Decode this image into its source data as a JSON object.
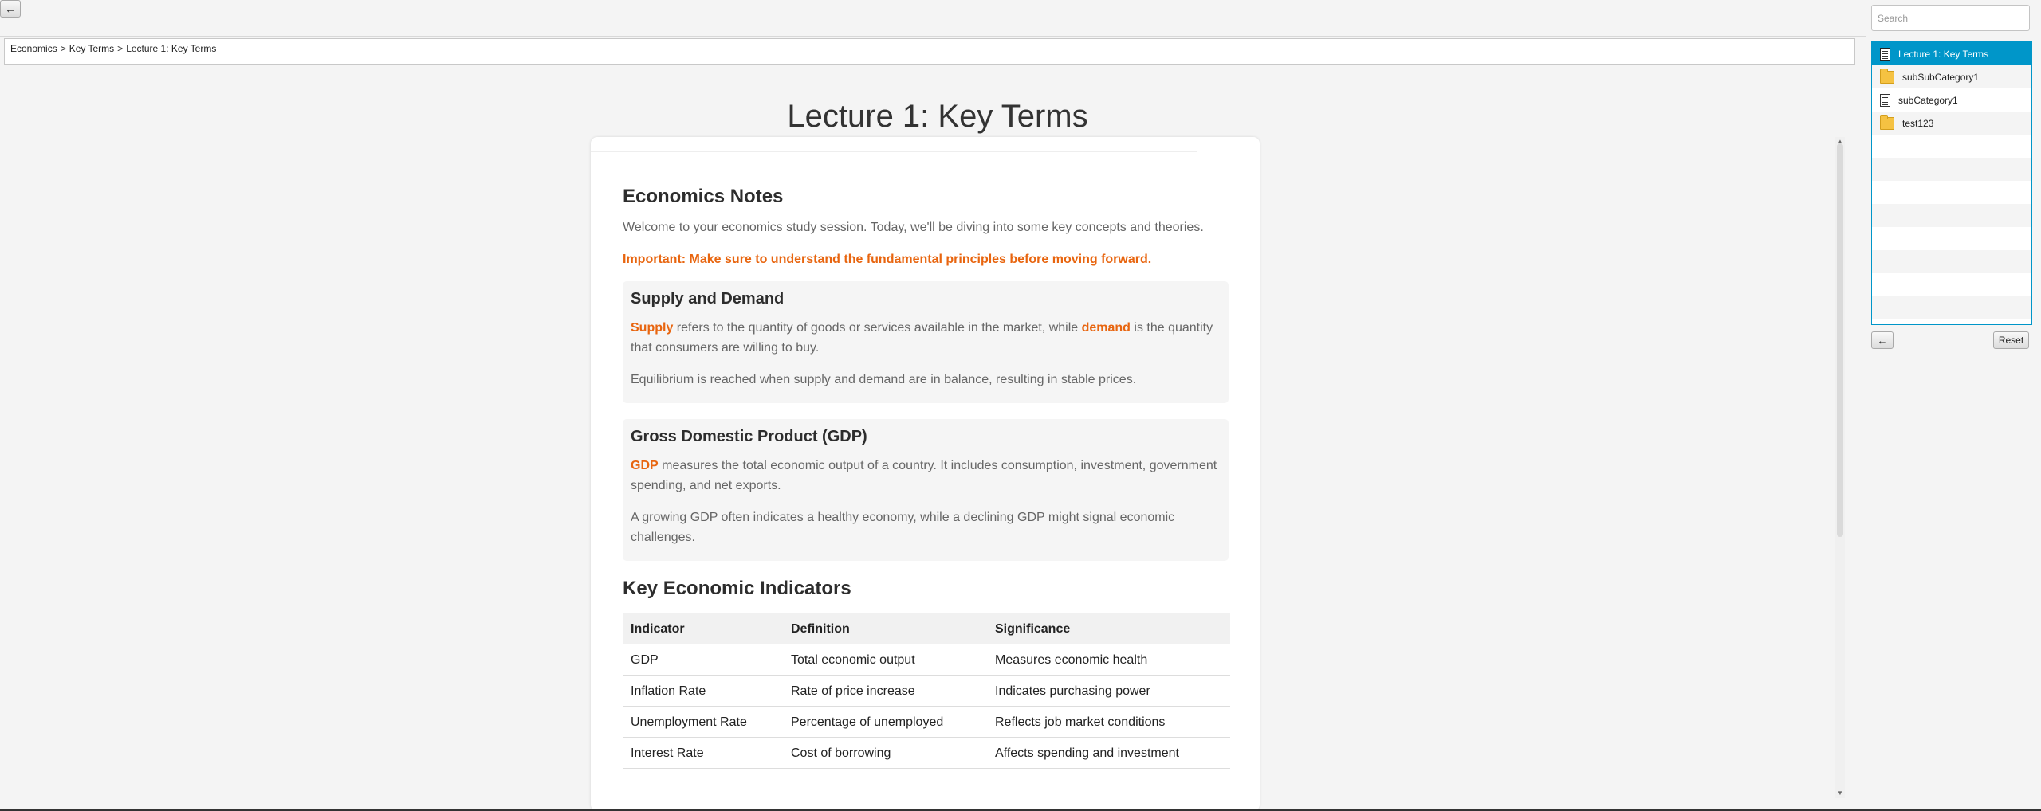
{
  "toolbar": {
    "back_icon": "left-arrow-icon",
    "back_glyph": "←"
  },
  "breadcrumb": {
    "items": [
      "Economics",
      "Key Terms",
      "Lecture 1: Key Terms"
    ],
    "separator": ">"
  },
  "page": {
    "title": "Lecture 1: Key Terms"
  },
  "content": {
    "notes_title": "Economics Notes",
    "intro": "Welcome to your economics study session. Today, we'll be diving into some key concepts and theories.",
    "important": "Important: Make sure to understand the fundamental principles before moving forward.",
    "supply_demand": {
      "heading": "Supply and Demand",
      "term1": "Supply",
      "text1a": " refers to the quantity of goods or services available in the market, while ",
      "term2": "demand",
      "text1b": " is the quantity that consumers are willing to buy.",
      "p2": "Equilibrium is reached when supply and demand are in balance, resulting in stable prices."
    },
    "gdp": {
      "heading": "Gross Domestic Product (GDP)",
      "term": "GDP",
      "text1": " measures the total economic output of a country. It includes consumption, investment, government spending, and net exports.",
      "p2": "A growing GDP often indicates a healthy economy, while a declining GDP might signal economic challenges."
    },
    "indicators_title": "Key Economic Indicators",
    "table": {
      "headers": [
        "Indicator",
        "Definition",
        "Significance"
      ],
      "rows": [
        [
          "GDP",
          "Total economic output",
          "Measures economic health"
        ],
        [
          "Inflation Rate",
          "Rate of price increase",
          "Indicates purchasing power"
        ],
        [
          "Unemployment Rate",
          "Percentage of unemployed",
          "Reflects job market conditions"
        ],
        [
          "Interest Rate",
          "Cost of borrowing",
          "Affects spending and investment"
        ]
      ]
    }
  },
  "sidebar": {
    "search_placeholder": "Search",
    "tree": [
      {
        "label": "Lecture 1: Key Terms",
        "icon": "document-icon",
        "selected": true
      },
      {
        "label": "subSubCategory1",
        "icon": "folder-icon",
        "selected": false
      },
      {
        "label": "subCategory1",
        "icon": "document-icon",
        "selected": false
      },
      {
        "label": "test123",
        "icon": "folder-icon",
        "selected": false
      }
    ],
    "back_glyph": "←",
    "reset_label": "Reset"
  },
  "colors": {
    "accent": "#0096c9",
    "highlight": "#e8650f"
  }
}
